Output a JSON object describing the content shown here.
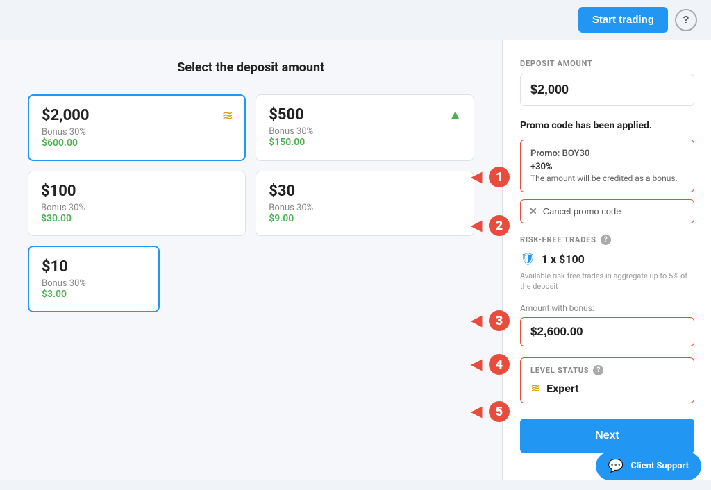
{
  "topbar": {
    "start_trading_label": "Start trading",
    "help_icon": "?"
  },
  "left_panel": {
    "title": "Select the deposit amount",
    "cards": [
      {
        "id": "card-2000",
        "amount": "$2,000",
        "bonus_label": "Bonus 30%",
        "bonus_value": "$600.00",
        "icon": "≋",
        "icon_class": "icon-gold",
        "selected": true
      },
      {
        "id": "card-500",
        "amount": "$500",
        "bonus_label": "Bonus 30%",
        "bonus_value": "$150.00",
        "icon": "⇑",
        "icon_class": "icon-green",
        "selected": false
      },
      {
        "id": "card-100",
        "amount": "$100",
        "bonus_label": "Bonus 30%",
        "bonus_value": "$30.00",
        "icon": "",
        "icon_class": "",
        "selected": false
      },
      {
        "id": "card-30",
        "amount": "$30",
        "bonus_label": "Bonus 30%",
        "bonus_value": "$9.00",
        "icon": "",
        "icon_class": "",
        "selected": false
      },
      {
        "id": "card-10",
        "amount": "$10",
        "bonus_label": "Bonus 30%",
        "bonus_value": "$3.00",
        "icon": "",
        "icon_class": "",
        "selected": true
      }
    ]
  },
  "right_panel": {
    "deposit_amount_label": "DEPOSIT AMOUNT",
    "deposit_amount_value": "$2,000",
    "promo_applied_text": "Promo code has been applied.",
    "promo_box": {
      "code_line": "Promo: BOY30",
      "percent_line": "+30%",
      "desc_line": "The amount will be credited as a bonus."
    },
    "cancel_promo_label": "Cancel promo code",
    "risk_free_trades_label": "RISK-FREE TRADES",
    "risk_free_amount": "1 x $100",
    "risk_free_note": "Available risk-free trades in aggregate up to 5% of the deposit",
    "amount_with_bonus_label": "Amount with bonus:",
    "amount_with_bonus_value": "$2,600.00",
    "level_status_label": "LEVEL STATUS",
    "level_name": "Expert",
    "next_button_label": "Next"
  },
  "annotations": [
    {
      "number": "1"
    },
    {
      "number": "2"
    },
    {
      "number": "3"
    },
    {
      "number": "4"
    },
    {
      "number": "5"
    }
  ],
  "client_support": {
    "label": "Client Support"
  }
}
